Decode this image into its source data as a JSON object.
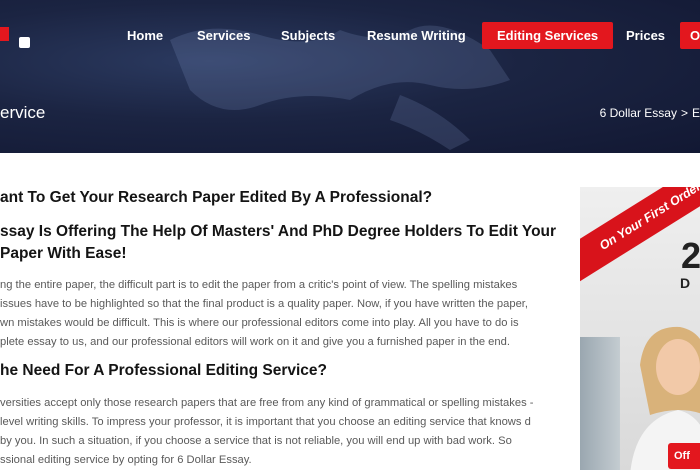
{
  "nav": {
    "items": [
      {
        "label": "Home"
      },
      {
        "label": "Services"
      },
      {
        "label": "Subjects"
      },
      {
        "label": "Resume Writing"
      },
      {
        "label": "Editing Services"
      },
      {
        "label": "Prices"
      },
      {
        "label": "O"
      }
    ],
    "active": "Editing Services",
    "accent_color": "#e3171e"
  },
  "page": {
    "heading": "ervice",
    "breadcrumb": [
      "6 Dollar Essay",
      ">",
      "E"
    ]
  },
  "content": {
    "heading1": "ant To Get Your Research Paper Edited By A Professional?",
    "heading2": "ssay Is Offering The Help Of Masters' And PhD Degree Holders To Edit Your Paper With Ease!",
    "para1": "ng the entire paper, the difficult part is to edit the paper from a critic's point of view. The spelling mistakes issues have to be highlighted so that the final product is a quality paper. Now, if you have written the paper, wn mistakes would be difficult. This is where our professional editors come into play. All you have to do is plete essay to us, and our professional editors will work on it and give you a furnished paper in the end.",
    "heading3": "he Need For A Professional Editing Service?",
    "para2": "versities accept only those research papers that are free from any kind of grammatical or spelling mistakes -level writing skills. To impress your professor, it is important that you choose an editing service that knows d by you. In such a situation, if you choose a service that is not reliable, you will end up with bad work. So ssional editing service by opting for 6 Dollar Essay."
  },
  "promo": {
    "ribbon": "On Your First Order!",
    "big": "2",
    "small": "D",
    "button": "Off"
  }
}
